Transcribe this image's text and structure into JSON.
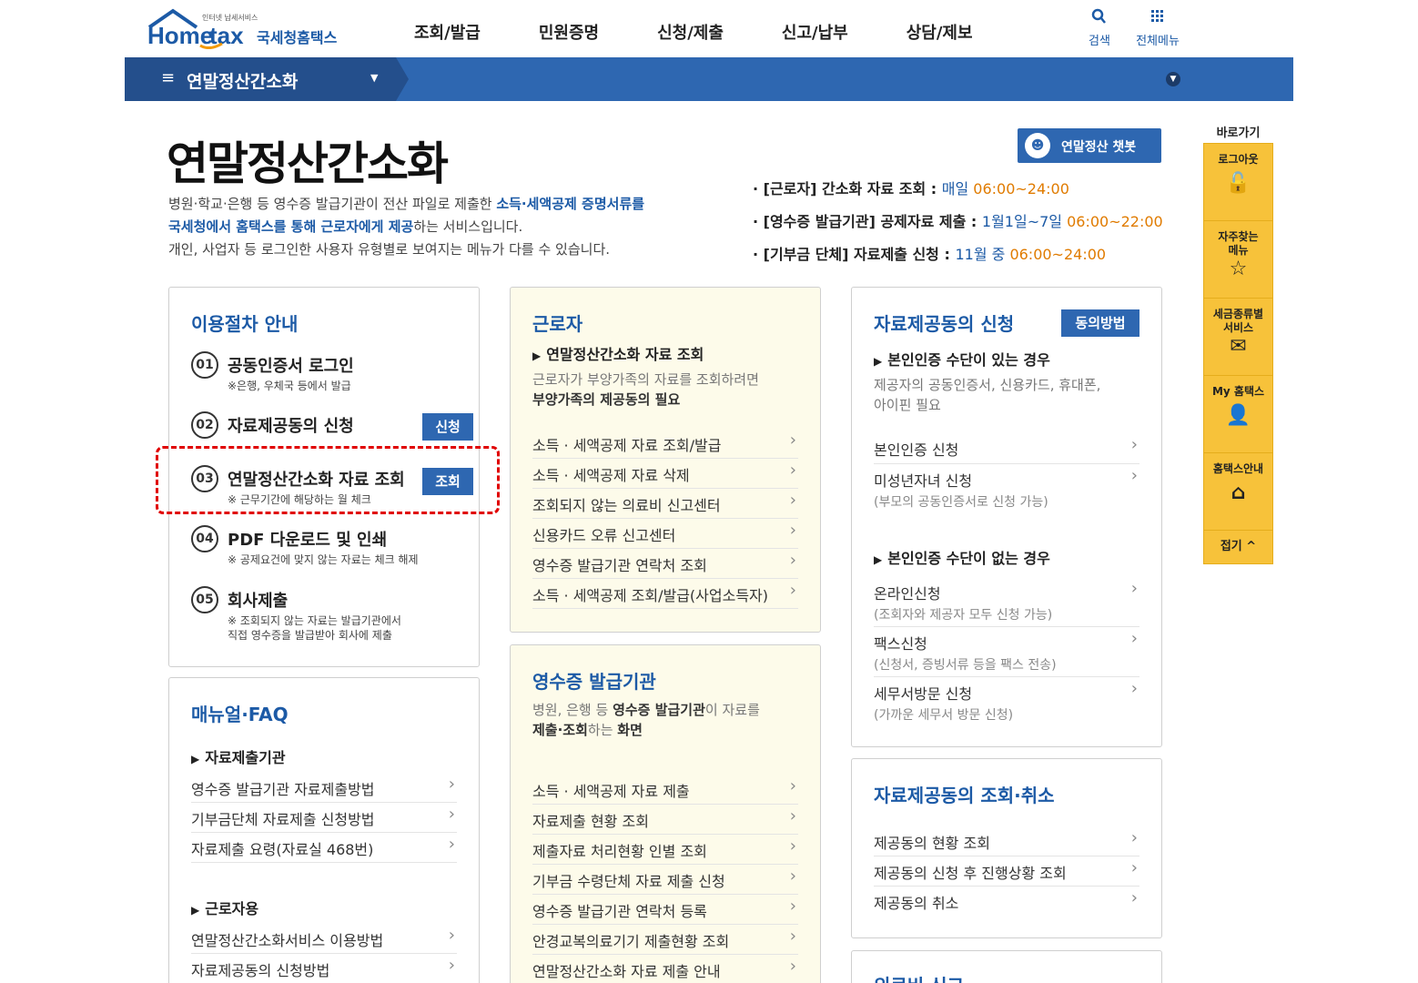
{
  "header": {
    "logo_small": "인터넷 납세서비스",
    "logo_ko": "국세청홈택스",
    "nav": [
      "조회/발급",
      "민원증명",
      "신청/제출",
      "신고/납부",
      "상담/제보"
    ],
    "search_label": "검색",
    "all_menu_label": "전체메뉴"
  },
  "menubar": {
    "title": "연말정산간소화"
  },
  "page": {
    "title": "연말정산간소화",
    "intro_1a": "병원·학교·은행 등 영수증 발급기관이 전산 파일로 제출한 ",
    "intro_1b": "소득·세액공제 증명서류를",
    "intro_2a": "국세청에서 홈택스를 통해 근로자에게 제공",
    "intro_2b": "하는 서비스입니다.",
    "intro_3": "개인, 사업자 등 로그인한 사용자 유형별로 보여지는 메뉴가 다를 수 있습니다.",
    "chatbot_label": "연말정산 챗봇"
  },
  "schedule": [
    {
      "label": "· [근로자] 간소화 자료 조회 : ",
      "blue": "매일 ",
      "orange": "06:00~24:00"
    },
    {
      "label": "· [영수증 발급기관] 공제자료 제출 : ",
      "blue": "1월1일~7일 ",
      "orange": "06:00~22:00"
    },
    {
      "label": "· [기부금 단체] 자료제출 신청 : ",
      "blue": "11월 중 ",
      "orange": "06:00~24:00"
    }
  ],
  "procedure": {
    "title": "이용절차 안내",
    "steps": [
      {
        "num": "01",
        "title": "공동인증서 로그인",
        "note": "※은행, 우체국 등에서 발급"
      },
      {
        "num": "02",
        "title": "자료제공동의 신청",
        "button": "신청"
      },
      {
        "num": "03",
        "title": "연말정산간소화 자료 조회",
        "note": "※ 근무기간에 해당하는 월 체크",
        "button": "조회"
      },
      {
        "num": "04",
        "title": "PDF 다운로드 및 인쇄",
        "note": "※ 공제요건에 맞지 않는 자료는 체크 해제"
      },
      {
        "num": "05",
        "title": "회사제출",
        "note": "※ 조회되지 않는 자료는 발급기관에서",
        "note2": "직접 영수증을 발급받아 회사에 제출"
      }
    ]
  },
  "manual": {
    "title": "매뉴얼·FAQ",
    "group1": "자료제출기관",
    "links1": [
      "영수증 발급기관 자료제출방법",
      "기부금단체 자료제출 신청방법",
      "자료제출 요령(자료실 468번)"
    ],
    "group2": "근로자용",
    "links2": [
      "연말정산간소화서비스 이용방법",
      "자료제공동의 신청방법"
    ]
  },
  "worker": {
    "title": "근로자",
    "sub": "연말정산간소화 자료 조회",
    "desc1": "근로자가 부양가족의 자료를 조회하려면",
    "desc2": "부양가족의 제공동의 필요",
    "links": [
      "소득 · 세액공제 자료 조회/발급",
      "소득 · 세액공제 자료 삭제",
      "조회되지 않는 의료비 신고센터",
      "신용카드 오류 신고센터",
      "영수증 발급기관 연락처 조회",
      "소득 · 세액공제 조회/발급(사업소득자)"
    ]
  },
  "issuer": {
    "title": "영수증 발급기관",
    "desc1a": "병원, 은행 등 ",
    "desc1b": "영수증 발급기관",
    "desc1c": "이 자료를",
    "desc2a": "제출·조회",
    "desc2b": "하는 ",
    "desc2c": "화면",
    "links": [
      "소득 · 세액공제 자료 제출",
      "자료제출 현황 조회",
      "제출자료 처리현황 인별 조회",
      "기부금 수령단체 자료 제출 신청",
      "영수증 발급기관 연락처 등록",
      "안경교복의료기기 제출현황 조회",
      "연말정산간소화 자료 제출 안내"
    ]
  },
  "consent": {
    "title": "자료제공동의 신청",
    "button": "동의방법",
    "sub1": "본인인증 수단이 있는 경우",
    "desc": "제공자의 공동인증서, 신용카드, 휴대폰,",
    "desc2": "아이핀 필요",
    "links1": [
      {
        "t": "본인인증 신청",
        "s": ""
      },
      {
        "t": "미성년자녀 신청",
        "s": "(부모의 공동인증서로 신청 가능)"
      }
    ],
    "sub2": "본인인증 수단이 없는 경우",
    "links2": [
      {
        "t": "온라인신청",
        "s": "(조회자와 제공자 모두 신청 가능)"
      },
      {
        "t": "팩스신청",
        "s": "(신청서, 증빙서류 등을 팩스 전송)"
      },
      {
        "t": "세무서방문 신청",
        "s": "(가까운 세무서 방문 신청)"
      }
    ]
  },
  "consent_view": {
    "title": "자료제공동의 조회·취소",
    "links": [
      "제공동의 현황 조회",
      "제공동의 신청 후 진행상황 조회",
      "제공동의 취소"
    ]
  },
  "next_card": {
    "title": "의료비 신고"
  },
  "quick": {
    "title": "바로가기",
    "items": [
      {
        "l1": "로그아웃",
        "l2": ""
      },
      {
        "l1": "자주찾는",
        "l2": "메뉴"
      },
      {
        "l1": "세금종류별",
        "l2": "서비스"
      },
      {
        "l1": "My 홈택스",
        "l2": ""
      },
      {
        "l1": "홈택스안내",
        "l2": ""
      }
    ],
    "fold": "접기 ^"
  }
}
